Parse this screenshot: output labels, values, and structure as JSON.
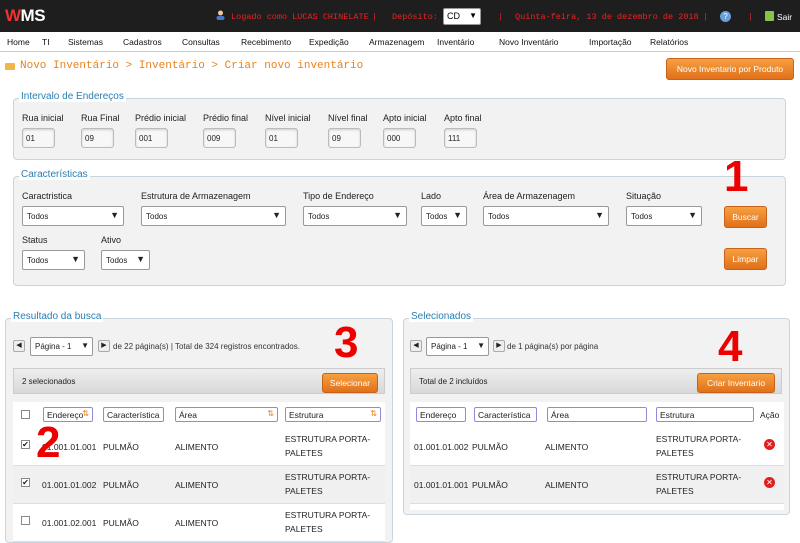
{
  "app": {
    "logo": "WMS"
  },
  "topbar": {
    "user_label": "Logado como LUCAS CHINELATE",
    "sep": "|",
    "deposito_label": "Depósito:",
    "deposito_value": "CD",
    "date": "Quinta-feira, 13 de dezembro de 2018",
    "exit_label": "Sair"
  },
  "menu": [
    "Home",
    "TI",
    "Sistemas",
    "Cadastros",
    "Consultas",
    "Recebimento",
    "Expedição",
    "Armazenagem",
    "Inventário",
    "Novo Inventário",
    "Importação",
    "Relatórios"
  ],
  "breadcrumb": "Novo Inventário > Inventário > Criar novo inventário",
  "top_button": "Novo Inventario por Produto",
  "intervalo": {
    "title": "Intervalo de Endereços",
    "fields": [
      {
        "label": "Rua inicial",
        "value": "01"
      },
      {
        "label": "Rua Final",
        "value": "09"
      },
      {
        "label": "Prédio inicial",
        "value": "001"
      },
      {
        "label": "Prédio final",
        "value": "009"
      },
      {
        "label": "Nível inicial",
        "value": "01"
      },
      {
        "label": "Nível final",
        "value": "09"
      },
      {
        "label": "Apto inicial",
        "value": "000"
      },
      {
        "label": "Apto final",
        "value": "111"
      }
    ]
  },
  "caracteristicas": {
    "title": "Características",
    "fields": [
      {
        "label": "Caractristica",
        "value": "Todos"
      },
      {
        "label": "Estrutura de Armazenagem",
        "value": "Todos"
      },
      {
        "label": "Tipo de Endereço",
        "value": "Todos"
      },
      {
        "label": "Lado",
        "value": "Todos"
      },
      {
        "label": "Área de Armazenagem",
        "value": "Todos"
      },
      {
        "label": "Situação",
        "value": "Todos"
      },
      {
        "label": "Status",
        "value": "Todos"
      },
      {
        "label": "Ativo",
        "value": "Todos"
      }
    ],
    "buscar": "Buscar",
    "limpar": "Limpar"
  },
  "annotations": [
    "1",
    "2",
    "3",
    "4"
  ],
  "resultado": {
    "title": "Resultado da busca",
    "page_select": "Página - 1",
    "page_info": "de 22 página(s) | Total de 324 registros encontrados.",
    "selected_count": "2 selecionados",
    "selecionar": "Selecionar",
    "headers": [
      "Endereço",
      "Característica",
      "Área",
      "Estrutura"
    ],
    "rows": [
      {
        "checked": "✔",
        "endereco": "01.001.01.001",
        "caracteristica": "PULMÃO",
        "area": "ALIMENTO",
        "estrutura": "ESTRUTURA PORTA-PALETES"
      },
      {
        "checked": "✔",
        "endereco": "01.001.01.002",
        "caracteristica": "PULMÃO",
        "area": "ALIMENTO",
        "estrutura": "ESTRUTURA PORTA-PALETES"
      },
      {
        "checked": "",
        "endereco": "01.001.02.001",
        "caracteristica": "PULMÃO",
        "area": "ALIMENTO",
        "estrutura": "ESTRUTURA PORTA-PALETES"
      }
    ]
  },
  "selecionados": {
    "title": "Selecionados",
    "page_select": "Página - 1",
    "page_info": "de 1 página(s) por página",
    "total": "Total de 2 incluídos",
    "criar": "Criar Inventario",
    "headers": [
      "Endereço",
      "Característica",
      "Área",
      "Estrutura",
      "Ação"
    ],
    "rows": [
      {
        "endereco": "01.001.01.002",
        "caracteristica": "PULMÃO",
        "area": "ALIMENTO",
        "estrutura": "ESTRUTURA PORTA-PALETES"
      },
      {
        "endereco": "01.001.01.001",
        "caracteristica": "PULMÃO",
        "area": "ALIMENTO",
        "estrutura": "ESTRUTURA PORTA-PALETES"
      }
    ]
  },
  "colors": {
    "accent": "#e8821e",
    "legend": "#2a7fb0",
    "topbar": "#1e1e1e",
    "annotation": "#e00000"
  },
  "icons": [
    "folder-icon",
    "user-icon",
    "help-icon",
    "exit-icon",
    "chevron-down-icon",
    "delete-icon"
  ]
}
